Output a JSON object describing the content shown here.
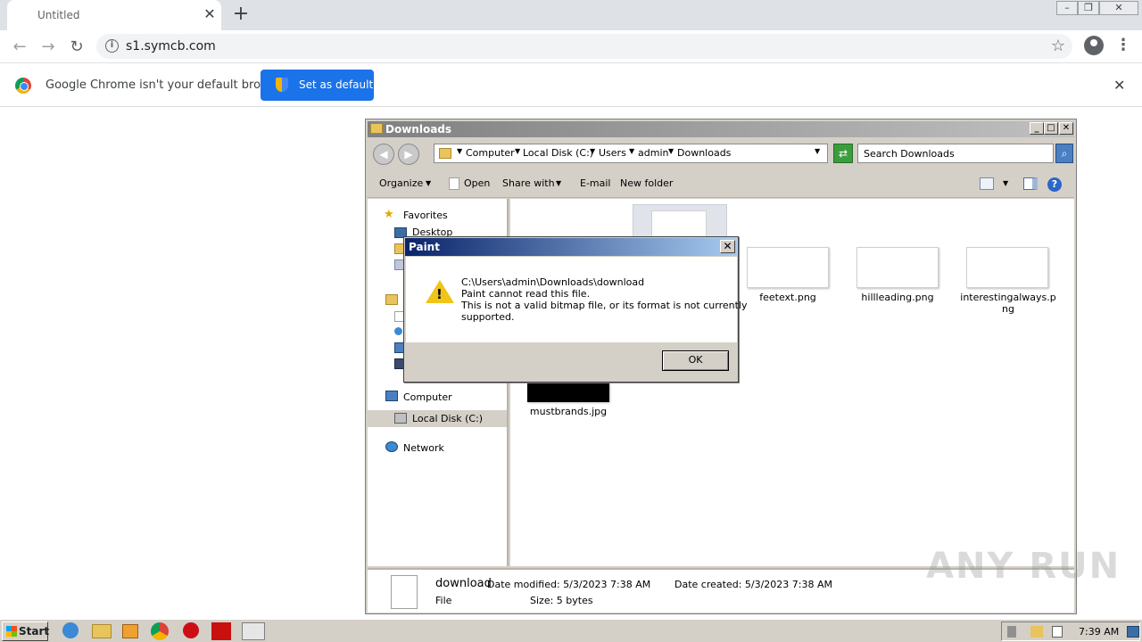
{
  "browser": {
    "tab_title": "Untitled",
    "tab_close": "✕",
    "new_tab": "+",
    "url": "s1.symcb.com",
    "back_icon": "←",
    "forward_icon": "→",
    "reload_icon": "↻",
    "bookmark_icon": "☆",
    "menu_icon": "⋮"
  },
  "infobar": {
    "message": "Google Chrome isn't your default browser",
    "button_label": "Set as default",
    "close": "✕"
  },
  "explorer": {
    "title": "Downloads",
    "breadcrumbs": [
      "Computer",
      "Local Disk (C:)",
      "Users",
      "admin",
      "Downloads"
    ],
    "search_placeholder": "Search Downloads",
    "commands": [
      "Organize",
      "Open",
      "Share with",
      "E-mail",
      "New folder"
    ],
    "nav": {
      "favorites": "Favorites",
      "desktop": "Desktop",
      "computer": "Computer",
      "local_disk": "Local Disk (C:)",
      "network": "Network"
    },
    "files": [
      "feetext.png",
      "hillleading.png",
      "interestingalways.png",
      "mustbrands.jpg"
    ],
    "details": {
      "name": "download",
      "type": "File",
      "modified": "Date modified: 5/3/2023 7:38 AM",
      "created": "Date created: 5/3/2023 7:38 AM",
      "size": "Size: 5 bytes"
    }
  },
  "dialog": {
    "title": "Paint",
    "close": "✕",
    "lines": [
      "C:\\Users\\admin\\Downloads\\download",
      "Paint cannot read this file.",
      "This is not a valid bitmap file, or its format is not currently",
      "supported."
    ],
    "ok_label": "OK"
  },
  "taskbar": {
    "start_label": "Start",
    "clock": "7:39 AM"
  },
  "watermark": "ANY RUN",
  "colors": {
    "chrome_blue": "#1a73e8",
    "dialog_title": "#0a246a",
    "classic_face": "#d4d0c8"
  }
}
